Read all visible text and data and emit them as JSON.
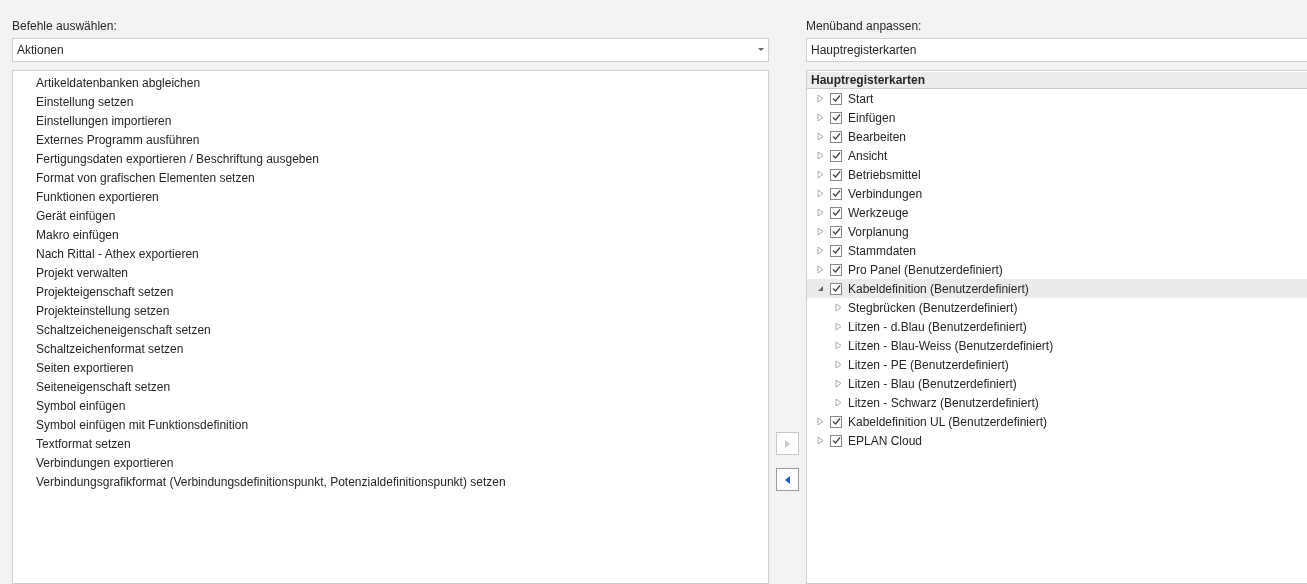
{
  "commands": {
    "label": "Befehle auswählen:",
    "dropdown": "Aktionen",
    "items": [
      "Artikeldatenbanken abgleichen",
      "Einstellung setzen",
      "Einstellungen importieren",
      "Externes Programm ausführen",
      "Fertigungsdaten exportieren / Beschriftung ausgeben",
      "Format von grafischen Elementen setzen",
      "Funktionen exportieren",
      "Gerät einfügen",
      "Makro einfügen",
      "Nach Rittal - Athex exportieren",
      "Projekt verwalten",
      "Projekteigenschaft setzen",
      "Projekteinstellung setzen",
      "Schaltzeicheneigenschaft setzen",
      "Schaltzeichenformat setzen",
      "Seiten exportieren",
      "Seiteneigenschaft setzen",
      "Symbol einfügen",
      "Symbol einfügen mit Funktionsdefinition",
      "Textformat setzen",
      "Verbindungen exportieren",
      "Verbindungsgrafikformat (Verbindungsdefinitionspunkt, Potenzialdefinitionspunkt) setzen"
    ]
  },
  "move_buttons": [
    {
      "kind": "add",
      "disabled": true
    },
    {
      "kind": "remove",
      "disabled": false
    }
  ],
  "ribbon": {
    "label": "Menüband anpassen:",
    "dropdown": "Hauptregisterkarten",
    "tree_header": "Hauptregisterkarten",
    "tree": [
      {
        "label": "Start",
        "checked": true,
        "expanded": false,
        "selected": false
      },
      {
        "label": "Einfügen",
        "checked": true,
        "expanded": false,
        "selected": false
      },
      {
        "label": "Bearbeiten",
        "checked": true,
        "expanded": false,
        "selected": false
      },
      {
        "label": "Ansicht",
        "checked": true,
        "expanded": false,
        "selected": false
      },
      {
        "label": "Betriebsmittel",
        "checked": true,
        "expanded": false,
        "selected": false
      },
      {
        "label": "Verbindungen",
        "checked": true,
        "expanded": false,
        "selected": false
      },
      {
        "label": "Werkzeuge",
        "checked": true,
        "expanded": false,
        "selected": false
      },
      {
        "label": "Vorplanung",
        "checked": true,
        "expanded": false,
        "selected": false
      },
      {
        "label": "Stammdaten",
        "checked": true,
        "expanded": false,
        "selected": false
      },
      {
        "label": "Pro Panel (Benutzerdefiniert)",
        "checked": true,
        "expanded": false,
        "selected": false
      },
      {
        "label": "Kabeldefinition (Benutzerdefiniert)",
        "checked": true,
        "expanded": true,
        "selected": true,
        "children": [
          {
            "label": "Stegbrücken (Benutzerdefiniert)",
            "expanded": false,
            "selected": false
          },
          {
            "label": "Litzen - d.Blau (Benutzerdefiniert)",
            "expanded": false,
            "selected": false
          },
          {
            "label": "Litzen - Blau-Weiss (Benutzerdefiniert)",
            "expanded": false,
            "selected": false
          },
          {
            "label": "Litzen - PE (Benutzerdefiniert)",
            "expanded": false,
            "selected": false
          },
          {
            "label": "Litzen - Blau (Benutzerdefiniert)",
            "expanded": false,
            "selected": false
          },
          {
            "label": "Litzen - Schwarz (Benutzerdefiniert)",
            "expanded": false,
            "selected": false
          }
        ]
      },
      {
        "label": "Kabeldefinition UL (Benutzerdefiniert)",
        "checked": true,
        "expanded": false,
        "selected": false
      },
      {
        "label": "EPLAN Cloud",
        "checked": true,
        "expanded": false,
        "selected": false
      }
    ]
  }
}
